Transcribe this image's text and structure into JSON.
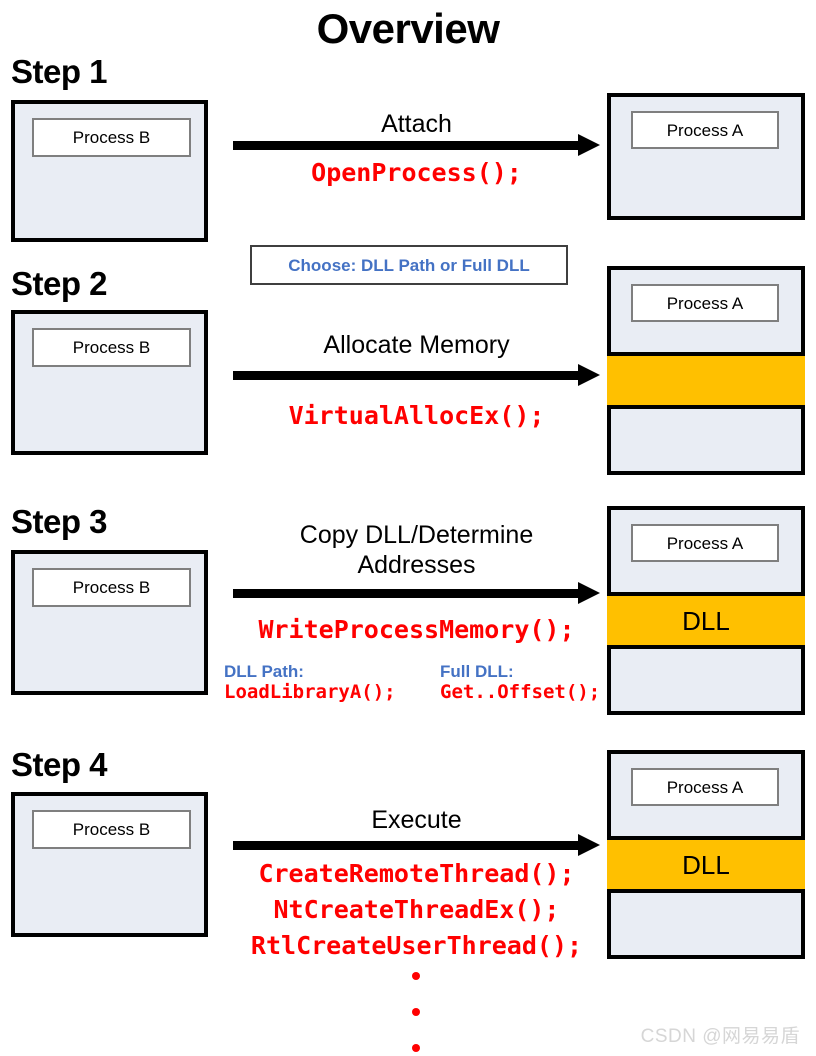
{
  "title": "Overview",
  "labels": {
    "process_a": "Process A",
    "process_b": "Process B",
    "dll": "DLL"
  },
  "colors": {
    "memory_highlight": "#FFC000",
    "process_fill": "#E9EDF4",
    "api_text": "#FF0000",
    "branch_text": "#4472C4",
    "outline": "#000000"
  },
  "choose_box": {
    "text": "Choose: DLL Path or Full DLL"
  },
  "steps": [
    {
      "heading": "Step 1",
      "action": "Attach",
      "apis": "OpenProcess();",
      "source_label": "Process B",
      "target_label": "Process A",
      "target_has_memory_band": false,
      "memory_band_label": ""
    },
    {
      "heading": "Step 2",
      "action": "Allocate Memory",
      "apis": "VirtualAllocEx();",
      "source_label": "Process B",
      "target_label": "Process A",
      "target_has_memory_band": true,
      "memory_band_label": ""
    },
    {
      "heading": "Step 3",
      "action": "Copy DLL/Determine\nAddresses",
      "action_line1": "Copy DLL/Determine",
      "action_line2": "Addresses",
      "apis": "WriteProcessMemory();",
      "source_label": "Process B",
      "target_label": "Process A",
      "target_has_memory_band": true,
      "memory_band_label": "DLL",
      "branches": [
        {
          "title": "DLL Path:",
          "call": "LoadLibraryA();"
        },
        {
          "title": "Full DLL:",
          "call": "Get..Offset();"
        }
      ]
    },
    {
      "heading": "Step 4",
      "action": "Execute",
      "apis_lines": [
        "CreateRemoteThread();",
        "NtCreateThreadEx();",
        "RtlCreateUserThread();"
      ],
      "continuation": "⋮",
      "source_label": "Process B",
      "target_label": "Process A",
      "target_has_memory_band": true,
      "memory_band_label": "DLL"
    }
  ],
  "watermark": "CSDN @网易易盾"
}
